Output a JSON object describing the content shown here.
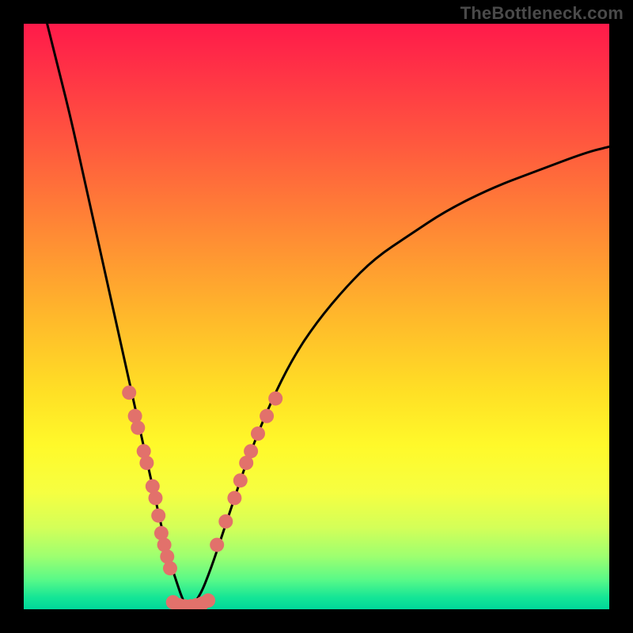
{
  "watermark": "TheBottleneck.com",
  "chart_data": {
    "type": "line",
    "title": "",
    "xlabel": "",
    "ylabel": "",
    "xlim": [
      0,
      100
    ],
    "ylim": [
      0,
      100
    ],
    "grid": false,
    "legend": false,
    "gradient_colors": [
      "#ff1a4a",
      "#ff5a3e",
      "#ffb82b",
      "#fff92a",
      "#9dff70",
      "#00d79a"
    ],
    "series": [
      {
        "name": "mismatch-curve-left",
        "color": "#000000",
        "x": [
          4,
          6,
          8,
          10,
          12,
          14,
          16,
          18,
          20,
          22,
          24,
          25,
          26,
          27,
          28
        ],
        "y": [
          100,
          92,
          84,
          75,
          66,
          57,
          48,
          39,
          30,
          21,
          12,
          8,
          5,
          2,
          0
        ]
      },
      {
        "name": "mismatch-curve-right",
        "color": "#000000",
        "x": [
          28,
          30,
          32,
          34,
          36,
          38,
          42,
          46,
          50,
          55,
          60,
          66,
          72,
          80,
          88,
          96,
          100
        ],
        "y": [
          0,
          2,
          7,
          13,
          19,
          25,
          35,
          43,
          49,
          55,
          60,
          64,
          68,
          72,
          75,
          78,
          79
        ]
      },
      {
        "name": "optimal-flat",
        "color": "#e2716b",
        "x": [
          25,
          26,
          27,
          28,
          29,
          30,
          31
        ],
        "y": [
          1,
          0.5,
          0.3,
          0.2,
          0.3,
          0.5,
          1
        ]
      }
    ],
    "markers": [
      {
        "cluster": "left-branch",
        "x": 18.0,
        "y": 37.0
      },
      {
        "cluster": "left-branch",
        "x": 19.0,
        "y": 33.0
      },
      {
        "cluster": "left-branch",
        "x": 19.5,
        "y": 31.0
      },
      {
        "cluster": "left-branch",
        "x": 20.5,
        "y": 27.0
      },
      {
        "cluster": "left-branch",
        "x": 21.0,
        "y": 25.0
      },
      {
        "cluster": "left-branch",
        "x": 22.0,
        "y": 21.0
      },
      {
        "cluster": "left-branch",
        "x": 22.5,
        "y": 19.0
      },
      {
        "cluster": "left-branch",
        "x": 23.0,
        "y": 16.0
      },
      {
        "cluster": "left-branch",
        "x": 23.5,
        "y": 13.0
      },
      {
        "cluster": "left-branch",
        "x": 24.0,
        "y": 11.0
      },
      {
        "cluster": "left-branch",
        "x": 24.5,
        "y": 9.0
      },
      {
        "cluster": "left-branch",
        "x": 25.0,
        "y": 7.0
      },
      {
        "cluster": "right-branch",
        "x": 33.0,
        "y": 11.0
      },
      {
        "cluster": "right-branch",
        "x": 34.5,
        "y": 15.0
      },
      {
        "cluster": "right-branch",
        "x": 36.0,
        "y": 19.0
      },
      {
        "cluster": "right-branch",
        "x": 37.0,
        "y": 22.0
      },
      {
        "cluster": "right-branch",
        "x": 38.0,
        "y": 25.0
      },
      {
        "cluster": "right-branch",
        "x": 38.8,
        "y": 27.0
      },
      {
        "cluster": "right-branch",
        "x": 40.0,
        "y": 30.0
      },
      {
        "cluster": "right-branch",
        "x": 41.5,
        "y": 33.0
      },
      {
        "cluster": "right-branch",
        "x": 43.0,
        "y": 36.0
      },
      {
        "cluster": "bottom-flat",
        "x": 25.5,
        "y": 1.2
      },
      {
        "cluster": "bottom-flat",
        "x": 26.5,
        "y": 0.7
      },
      {
        "cluster": "bottom-flat",
        "x": 27.5,
        "y": 0.5
      },
      {
        "cluster": "bottom-flat",
        "x": 28.5,
        "y": 0.5
      },
      {
        "cluster": "bottom-flat",
        "x": 29.5,
        "y": 0.7
      },
      {
        "cluster": "bottom-flat",
        "x": 30.5,
        "y": 1.0
      },
      {
        "cluster": "bottom-flat",
        "x": 31.5,
        "y": 1.5
      }
    ],
    "marker_style": {
      "color": "#e2716b",
      "radius_px": 9
    }
  }
}
